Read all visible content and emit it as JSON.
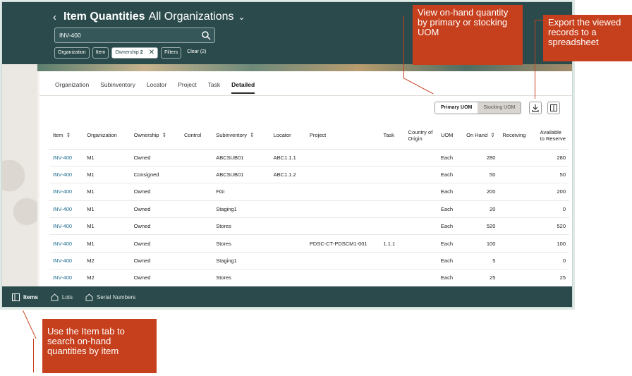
{
  "header": {
    "title_main": "Item Quantities",
    "title_sub": "All Organizations",
    "search_value": "INV-400",
    "chips": [
      {
        "label": "Organization"
      },
      {
        "label": "Item"
      },
      {
        "label": "Ownership",
        "count": "2"
      },
      {
        "label": "Filters"
      },
      {
        "label": "Clear (2)"
      }
    ]
  },
  "tabs": [
    "Organization",
    "Subinventory",
    "Locator",
    "Project",
    "Task",
    "Detailed"
  ],
  "active_tab": "Detailed",
  "uom_toggle": {
    "primary": "Primary UOM",
    "stocking": "Stocking UOM"
  },
  "table": {
    "headers": [
      "Item",
      "Organization",
      "Ownership",
      "Control",
      "Subinventory",
      "Locator",
      "Project",
      "Task",
      "Country of Origin",
      "UOM",
      "On Hand",
      "Receiving",
      "Available to Reserve"
    ],
    "rows": [
      [
        "INV-400",
        "M1",
        "Owned",
        "",
        "ABCSUB01",
        "ABC1.1.1",
        "",
        "",
        "",
        "Each",
        "280",
        "",
        "280"
      ],
      [
        "INV-400",
        "M1",
        "Consigned",
        "",
        "ABCSUB01",
        "ABC1.1.2",
        "",
        "",
        "",
        "Each",
        "50",
        "",
        "50"
      ],
      [
        "INV-400",
        "M1",
        "Owned",
        "",
        "FGI",
        "",
        "",
        "",
        "",
        "Each",
        "200",
        "",
        "200"
      ],
      [
        "INV-400",
        "M1",
        "Owned",
        "",
        "Staging1",
        "",
        "",
        "",
        "",
        "Each",
        "20",
        "",
        "0"
      ],
      [
        "INV-400",
        "M1",
        "Owned",
        "",
        "Stores",
        "",
        "",
        "",
        "",
        "Each",
        "520",
        "",
        "520"
      ],
      [
        "INV-400",
        "M1",
        "Owned",
        "",
        "Stores",
        "",
        "PDSC-CT-PDSCM1-001",
        "1.1.1",
        "",
        "Each",
        "100",
        "",
        "100"
      ],
      [
        "INV-400",
        "M2",
        "Owned",
        "",
        "Staging1",
        "",
        "",
        "",
        "",
        "Each",
        "5",
        "",
        "0"
      ],
      [
        "INV-400",
        "M2",
        "Owned",
        "",
        "Stores",
        "",
        "",
        "",
        "",
        "Each",
        "25",
        "",
        "25"
      ]
    ]
  },
  "bottom_nav": [
    {
      "label": "Items",
      "icon": "items-panel-icon"
    },
    {
      "label": "Lots",
      "icon": "lots-tag-icon"
    },
    {
      "label": "Serial Numbers",
      "icon": "serial-tag-icon"
    }
  ],
  "callouts": {
    "uom": "View on-hand quantity by primary or stocking UOM",
    "export": "Export the viewed records to a spreadsheet",
    "items": "Use the Item tab to search on-hand quantities by item"
  },
  "colors": {
    "header": "#2b4a4b",
    "callout": "#c7401d",
    "link": "#1f6d8d"
  }
}
